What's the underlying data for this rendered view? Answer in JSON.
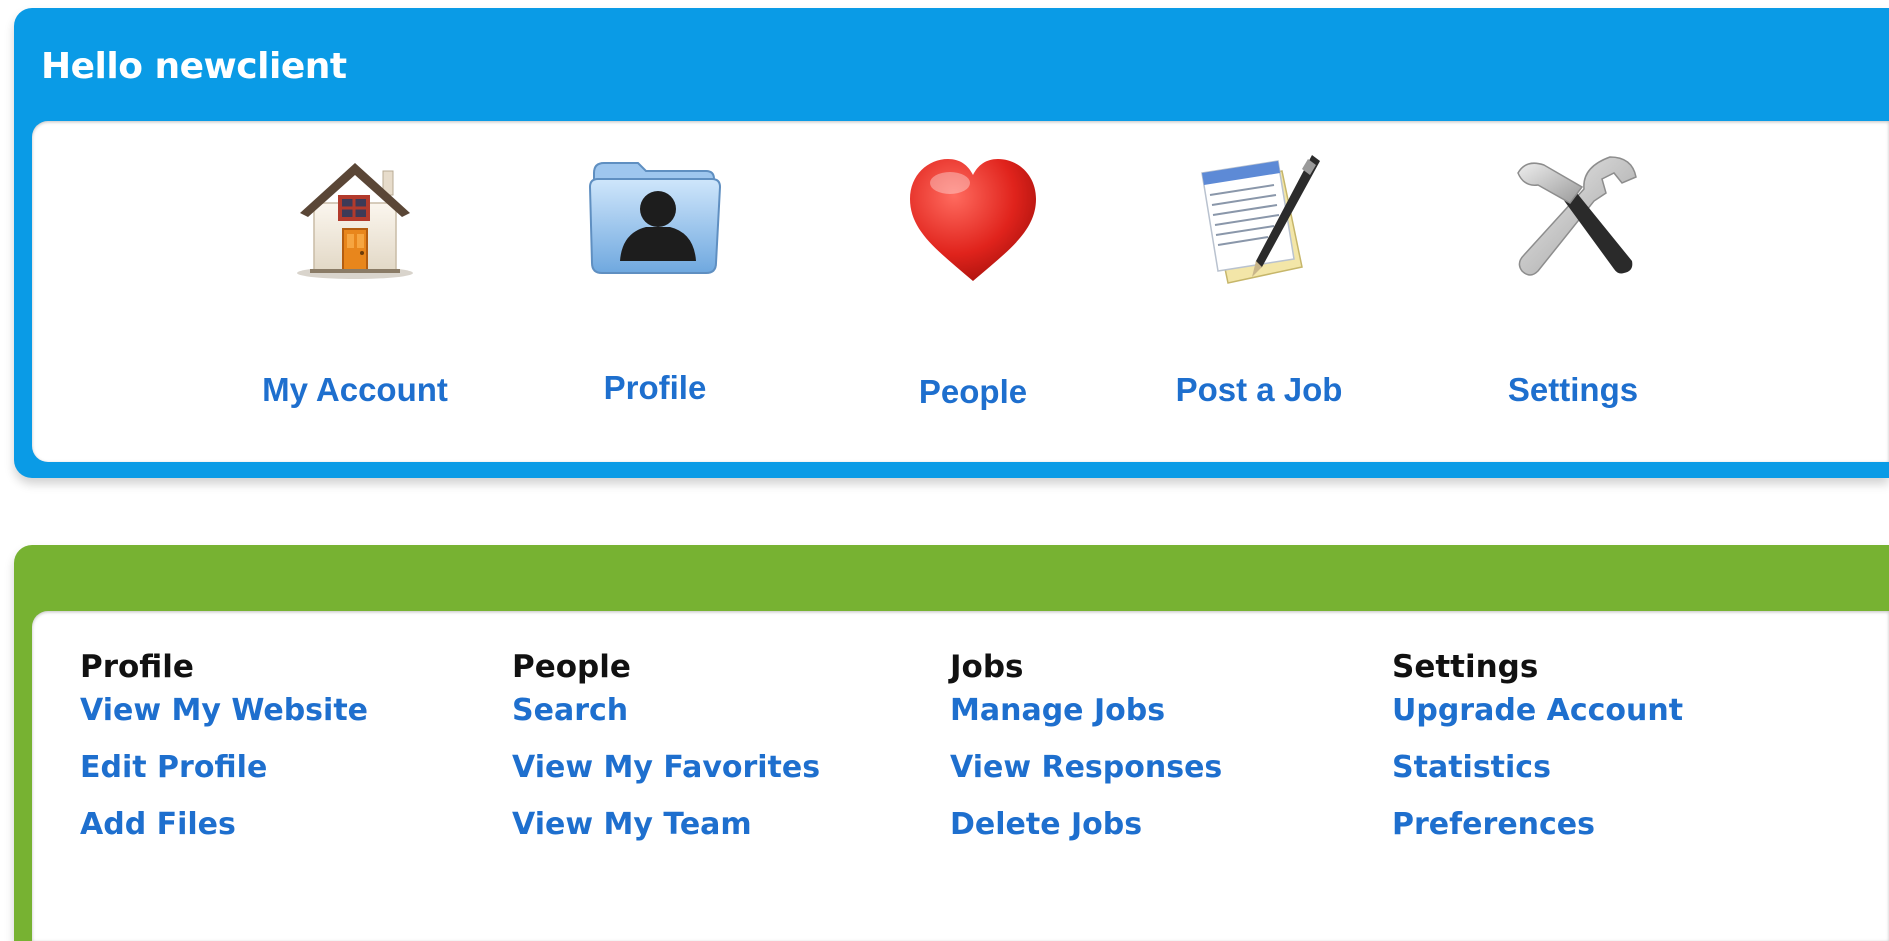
{
  "greeting": "Hello newclient",
  "colors": {
    "blue_panel": "#0a9be6",
    "green_panel": "#77b232",
    "link": "#1e6fce"
  },
  "nav": [
    {
      "label": "My Account",
      "icon": "house-icon"
    },
    {
      "label": "Profile",
      "icon": "profile-folder-icon"
    },
    {
      "label": "People",
      "icon": "heart-icon"
    },
    {
      "label": "Post a Job",
      "icon": "document-pen-icon"
    },
    {
      "label": "Settings",
      "icon": "tools-icon"
    }
  ],
  "columns": [
    {
      "heading": "Profile",
      "links": [
        "View My Website",
        "Edit Profile",
        "Add Files"
      ]
    },
    {
      "heading": "People",
      "links": [
        "Search",
        "View My Favorites",
        "View My Team"
      ]
    },
    {
      "heading": "Jobs",
      "links": [
        "Manage Jobs",
        "View Responses",
        "Delete Jobs"
      ]
    },
    {
      "heading": "Settings",
      "links": [
        "Upgrade Account",
        "Statistics",
        "Preferences"
      ]
    }
  ]
}
